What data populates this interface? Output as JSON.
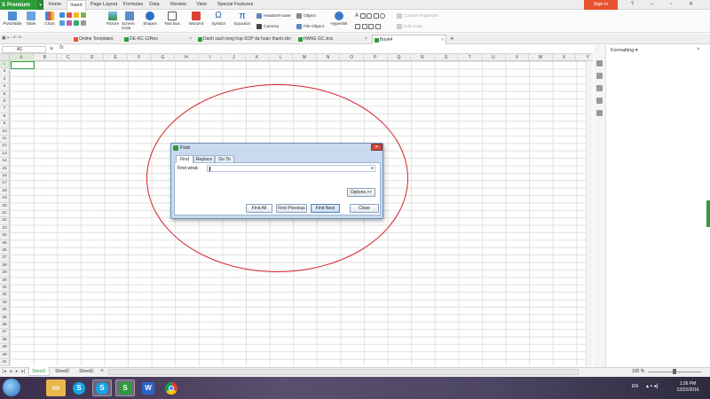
{
  "app": {
    "premium_label": "Premium",
    "menu_tabs": [
      "Home",
      "Insert",
      "Page Layout",
      "Formulas",
      "Data",
      "Review",
      "View",
      "Special Features"
    ],
    "active_menu_tab": "Insert",
    "signin_label": "Sign in",
    "window_controls": [
      "?",
      "–",
      "▫",
      "✕"
    ]
  },
  "ribbon": {
    "large_buttons": [
      "PivotTable",
      "Table",
      "Chart",
      "Picture",
      "Screen Grab",
      "Shapes",
      "Text Box",
      "WordArt",
      "Symbol",
      "Equation",
      "Hyperlink"
    ],
    "small_buttons": [
      "Header/Footer",
      "Object",
      "Camera",
      "File Object",
      "Control Properties",
      "Edit Code"
    ]
  },
  "doc_tabs": [
    "Online Templates",
    "DE-KC-12Reo",
    "Danh sach tong hop SOP da hoan thanh.xls",
    "HANG GC.xlsx",
    "Book4"
  ],
  "active_doc_tab": "Book4",
  "formula_bar": {
    "name_box": "A1",
    "fx_label": "fx"
  },
  "grid": {
    "columns": [
      "A",
      "B",
      "C",
      "D",
      "E",
      "F",
      "G",
      "H",
      "I",
      "J",
      "K",
      "L",
      "M",
      "N",
      "O",
      "P",
      "Q",
      "R",
      "S",
      "T",
      "U",
      "V",
      "W",
      "X",
      "Y"
    ],
    "rows": [
      "1",
      "2",
      "3",
      "4",
      "5",
      "6",
      "7",
      "8",
      "9",
      "10",
      "11",
      "12",
      "13",
      "14",
      "15",
      "16",
      "17",
      "18",
      "19",
      "20",
      "21",
      "22",
      "23",
      "24",
      "25",
      "26",
      "27",
      "28",
      "29",
      "30",
      "31",
      "32",
      "33",
      "34",
      "35",
      "36",
      "37",
      "38",
      "39",
      "40",
      "41"
    ]
  },
  "right_panel": {
    "title": "Formatting"
  },
  "sheets": [
    "Sheet1",
    "Sheet2",
    "Sheet3"
  ],
  "active_sheet": "Sheet1",
  "zoom": "100 %",
  "find_dialog": {
    "title": "Find",
    "tabs": [
      "Find",
      "Replace",
      "Go To"
    ],
    "active_tab": "Find",
    "find_what_label": "Find what:",
    "find_what_value": "",
    "options_button": "Options >>",
    "buttons": [
      "Find All",
      "Find Previous",
      "Find Next",
      "Close"
    ]
  },
  "taskbar": {
    "apps": [
      "folder",
      "skype",
      "spreadsheet",
      "writer",
      "chrome"
    ],
    "language": "EN",
    "time": "1:26 PM",
    "date": "12/22/2016"
  },
  "colors": {
    "accent_green": "#2f9c3c",
    "signin_orange": "#e8522f",
    "annotation_red": "#d4202a"
  }
}
